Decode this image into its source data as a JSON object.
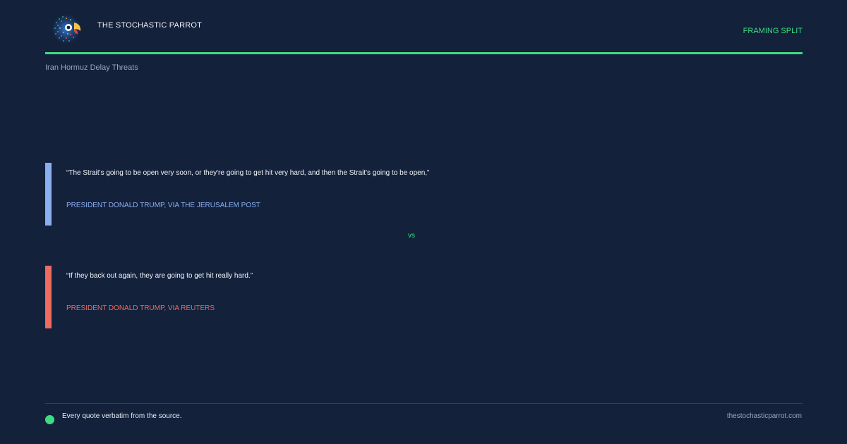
{
  "header": {
    "brand": "THE STOCHASTIC PARROT",
    "tag": "FRAMING SPLIT",
    "logo_icon": "parrot-logo-icon"
  },
  "topic": "Iran Hormuz Delay Threats",
  "quotes": [
    {
      "text": "“The Strait's going to be open very soon, or they're going to get hit very hard, and then the Strait's going to be open,”",
      "attribution": "PRESIDENT DONALD TRUMP, VIA THE JERUSALEM POST",
      "accent": "#8aaef0"
    },
    {
      "text": "“If they back out again, they are going to get hit really hard.”",
      "attribution": "PRESIDENT DONALD TRUMP, VIA REUTERS",
      "accent": "#ee6b5f"
    }
  ],
  "separator": "vs",
  "footer": {
    "note": "Every quote verbatim from the source.",
    "url": "thestochasticparrot.com"
  },
  "colors": {
    "background": "#13213b",
    "accent": "#3ddc84"
  }
}
